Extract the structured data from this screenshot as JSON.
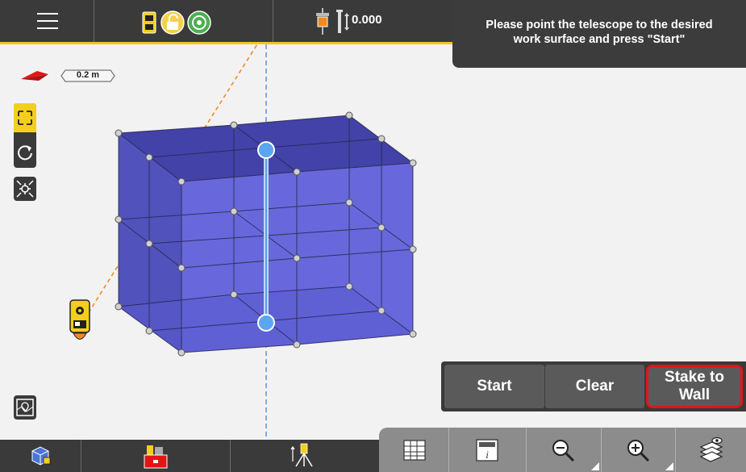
{
  "header": {
    "height_value": "0.000",
    "accent_color": "#f6c61c"
  },
  "instruction": {
    "line1": "Please point the telescope to the desired",
    "line2": "work surface and press \"Start\""
  },
  "scale": {
    "label": "0.2 m"
  },
  "actions": {
    "start_label": "Start",
    "clear_label": "Clear",
    "stake_line1": "Stake to",
    "stake_line2": "Wall"
  },
  "icons": {
    "top": [
      "menu-icon",
      "instrument-status-icon",
      "lock-icon",
      "target-icon",
      "prism-icon",
      "height-icon"
    ],
    "left": [
      "north-arrow-icon",
      "fit-view-icon",
      "rotate-view-icon",
      "center-view-icon",
      "map-view-icon"
    ],
    "bottom": [
      "3d-model-icon",
      "toolbox-icon",
      "setup-icon",
      "table-icon",
      "info-icon",
      "zoom-out-icon",
      "zoom-in-icon",
      "layers-icon"
    ]
  },
  "colors": {
    "cube_face": "#6b6be0",
    "cube_dark": "#4a4ab8",
    "highlight_border": "#e01616",
    "selected_line": "#6ea8f0"
  }
}
